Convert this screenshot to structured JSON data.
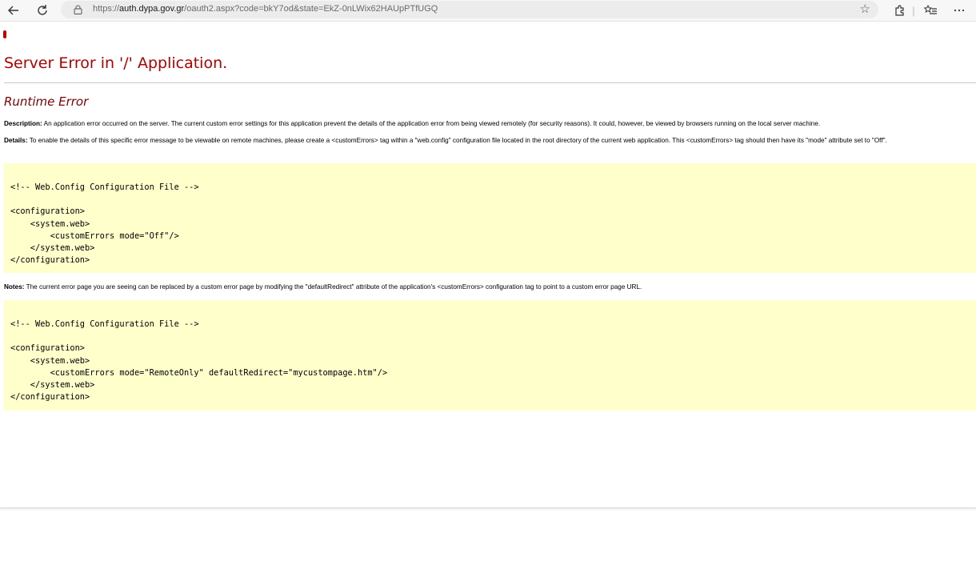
{
  "browser": {
    "url_scheme": "https://",
    "url_host": "auth.dypa.gov.gr",
    "url_path": "/oauth2.aspx?code=bkY7od&state=EkZ-0nLWix62HAUpPTfUGQ",
    "icons": [
      "back-arrow-icon",
      "refresh-icon",
      "lock-icon",
      "star-icon",
      "extensions-icon",
      "favorites-icon",
      "more-icon"
    ]
  },
  "page": {
    "title": "Server Error in '/' Application.",
    "subtitle": "Runtime Error",
    "description_label": "Description:",
    "description_text": " An application error occurred on the server. The current custom error settings for this application prevent the details of the application error from being viewed remotely (for security reasons). It could, however, be viewed by browsers running on the local server machine.",
    "details_label": "Details:",
    "details_text": " To enable the details of this specific error message to be viewable on remote machines, please create a <customErrors> tag within a \"web.config\" configuration file located in the root directory of the current web application. This <customErrors> tag should then have its \"mode\" attribute set to \"Off\".",
    "code1": "<!-- Web.Config Configuration File -->\n\n<configuration>\n    <system.web>\n        <customErrors mode=\"Off\"/>\n    </system.web>\n</configuration>",
    "notes_label": "Notes:",
    "notes_text": " The current error page you are seeing can be replaced by a custom error page by modifying the \"defaultRedirect\" attribute of the application's <customErrors> configuration tag to point to a custom error page URL.",
    "code2": "<!-- Web.Config Configuration File -->\n\n<configuration>\n    <system.web>\n        <customErrors mode=\"RemoteOnly\" defaultRedirect=\"mycustompage.htm\"/>\n    </system.web>\n</configuration>"
  },
  "colors": {
    "title": "#b00000",
    "subtitle": "#800000",
    "code_bg": "#ffffcc"
  }
}
